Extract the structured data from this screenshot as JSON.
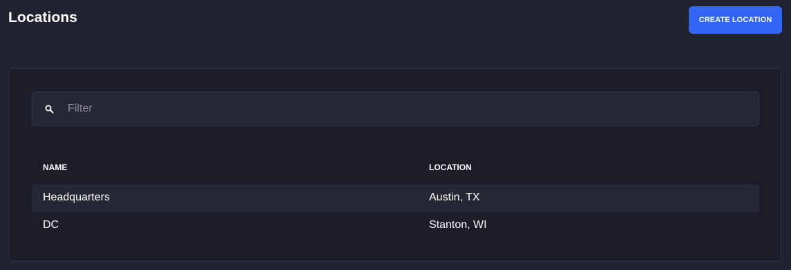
{
  "header": {
    "title": "Locations",
    "create_button_label": "CREATE LOCATION"
  },
  "filter": {
    "placeholder": "Filter",
    "value": "",
    "icon": "search-icon"
  },
  "table": {
    "columns": [
      "NAME",
      "LOCATION"
    ],
    "rows": [
      {
        "name": "Headquarters",
        "location": "Austin, TX"
      },
      {
        "name": "DC",
        "location": "Stanton, WI"
      }
    ]
  },
  "colors": {
    "background": "#222330",
    "panel": "#1d1d29",
    "accent": "#3366f5",
    "row_highlight": "#262734"
  }
}
